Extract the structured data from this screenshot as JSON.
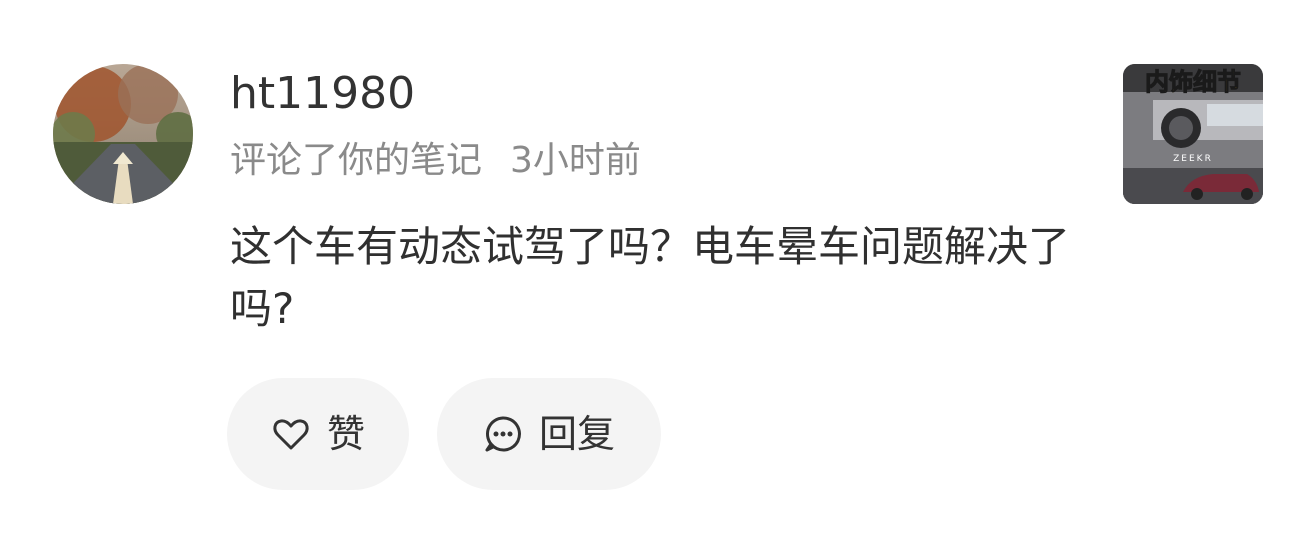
{
  "user": {
    "name": "ht11980",
    "action": "评论了你的笔记",
    "time": "3小时前"
  },
  "comment": {
    "text": "这个车有动态试驾了吗？电车晕车问题解决了吗?"
  },
  "note_thumbnail": {
    "overlay_title": "内饰细节",
    "brand": "ZEEKR"
  },
  "actions": {
    "like_label": "赞",
    "reply_label": "回复"
  },
  "icons": {
    "like": "heart-outline-icon",
    "reply": "comment-bubble-icon"
  },
  "colors": {
    "primary_text": "#333333",
    "secondary_text": "#8a8a8a",
    "button_bg": "#f4f4f4",
    "thumb_title": "#f5c518"
  }
}
